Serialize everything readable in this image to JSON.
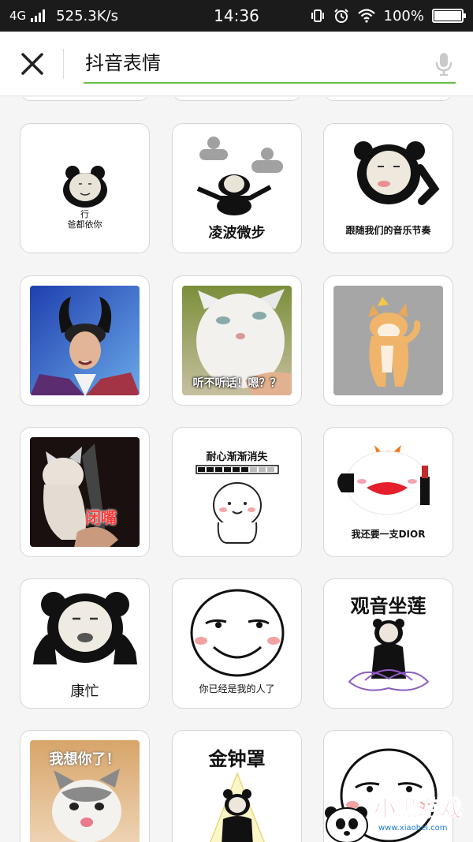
{
  "status_bar": {
    "network": "4G",
    "speed": "525.3K/s",
    "time": "14:36",
    "battery": "100%",
    "battery_level": 1.0
  },
  "search": {
    "query": "抖音表情"
  },
  "stickers": [
    {
      "caption": "行\n爸都依你"
    },
    {
      "caption": "凌波微步"
    },
    {
      "caption": "跟随我们的音乐节奏"
    },
    {
      "caption": ""
    },
    {
      "caption": "听不听话！嗯？？"
    },
    {
      "caption": ""
    },
    {
      "caption": "闭嘴"
    },
    {
      "caption": "耐心渐渐消失"
    },
    {
      "caption": "我还要一支DIOR"
    },
    {
      "caption": "康忙"
    },
    {
      "caption": "你已经是我的人了"
    },
    {
      "caption": "观音坐莲"
    },
    {
      "caption": "我想你了！"
    },
    {
      "caption": "金钟罩"
    },
    {
      "caption": ""
    }
  ],
  "watermark": {
    "text": "小黑游戏",
    "url_text": "www.xiaohei.com"
  }
}
